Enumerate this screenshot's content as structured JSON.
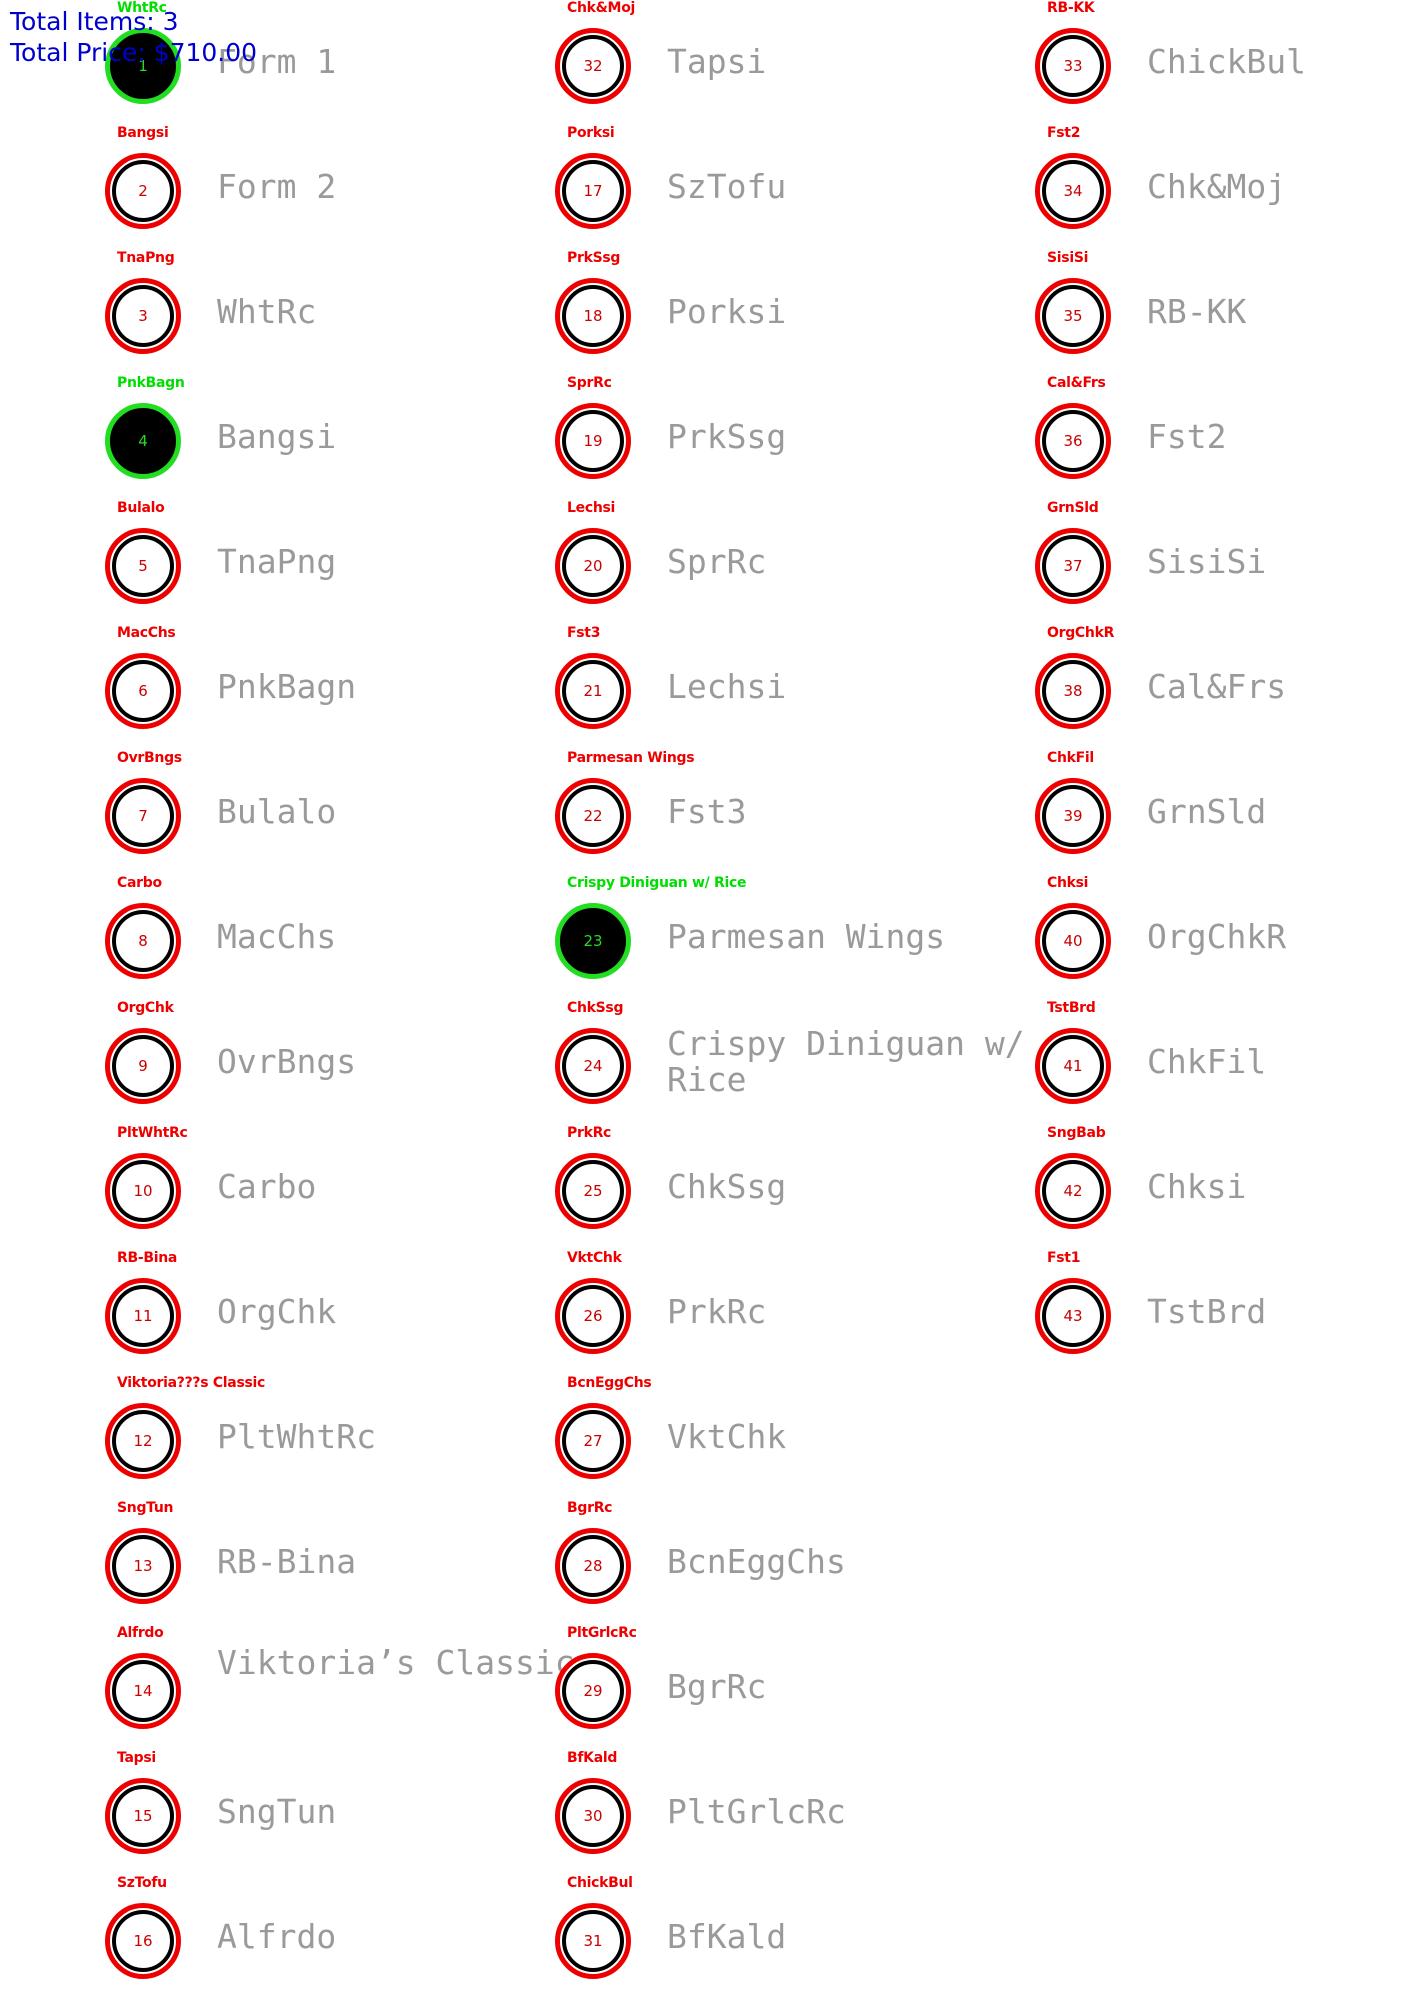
{
  "summary": {
    "total_items": "Total Items: 3",
    "total_price": "Total Price: $710.00"
  },
  "colors": {
    "selected": "#22dd22",
    "unselected": "#ee0000",
    "summary": "#0000cc",
    "name": "#9a9a9a"
  },
  "icon": "circle-select-icon",
  "items": [
    {
      "number": "1",
      "tag": "WhtRc",
      "name": "Form 1",
      "selected": true
    },
    {
      "number": "2",
      "tag": "Bangsi",
      "name": "Form 2",
      "selected": false
    },
    {
      "number": "3",
      "tag": "TnaPng",
      "name": "WhtRc",
      "selected": false
    },
    {
      "number": "4",
      "tag": "PnkBagn",
      "name": "Bangsi",
      "selected": true
    },
    {
      "number": "5",
      "tag": "Bulalo",
      "name": "TnaPng",
      "selected": false
    },
    {
      "number": "6",
      "tag": "MacChs",
      "name": "PnkBagn",
      "selected": false
    },
    {
      "number": "7",
      "tag": "OvrBngs",
      "name": "Bulalo",
      "selected": false
    },
    {
      "number": "8",
      "tag": "Carbo",
      "name": "MacChs",
      "selected": false
    },
    {
      "number": "9",
      "tag": "OrgChk",
      "name": "OvrBngs",
      "selected": false
    },
    {
      "number": "10",
      "tag": "PltWhtRc",
      "name": "Carbo",
      "selected": false
    },
    {
      "number": "11",
      "tag": "RB-Bina",
      "name": "OrgChk",
      "selected": false
    },
    {
      "number": "12",
      "tag": "Viktoria???s Classic",
      "name": "PltWhtRc",
      "selected": false
    },
    {
      "number": "13",
      "tag": "SngTun",
      "name": "RB-Bina",
      "selected": false
    },
    {
      "number": "14",
      "tag": "Alfrdo",
      "name": "Viktoria’s Classic",
      "selected": false
    },
    {
      "number": "15",
      "tag": "Tapsi",
      "name": "SngTun",
      "selected": false
    },
    {
      "number": "16",
      "tag": "SzTofu",
      "name": "Alfrdo",
      "selected": false
    },
    {
      "number": "32",
      "tag": "Chk&Moj",
      "name": "Tapsi",
      "selected": false
    },
    {
      "number": "17",
      "tag": "Porksi",
      "name": "SzTofu",
      "selected": false
    },
    {
      "number": "18",
      "tag": "PrkSsg",
      "name": "Porksi",
      "selected": false
    },
    {
      "number": "19",
      "tag": "SprRc",
      "name": "PrkSsg",
      "selected": false
    },
    {
      "number": "20",
      "tag": "Lechsi",
      "name": "SprRc",
      "selected": false
    },
    {
      "number": "21",
      "tag": "Fst3",
      "name": "Lechsi",
      "selected": false
    },
    {
      "number": "22",
      "tag": "Parmesan Wings",
      "name": "Fst3",
      "selected": false
    },
    {
      "number": "23",
      "tag": "Crispy Diniguan w/ Rice",
      "name": "Parmesan Wings",
      "selected": true
    },
    {
      "number": "24",
      "tag": "ChkSsg",
      "name": "Crispy Diniguan w/ Rice",
      "selected": false
    },
    {
      "number": "25",
      "tag": "PrkRc",
      "name": "ChkSsg",
      "selected": false
    },
    {
      "number": "26",
      "tag": "VktChk",
      "name": "PrkRc",
      "selected": false
    },
    {
      "number": "27",
      "tag": "BcnEggChs",
      "name": "VktChk",
      "selected": false
    },
    {
      "number": "28",
      "tag": "BgrRc",
      "name": "BcnEggChs",
      "selected": false
    },
    {
      "number": "29",
      "tag": "PltGrlcRc",
      "name": "BgrRc",
      "selected": false
    },
    {
      "number": "30",
      "tag": "BfKald",
      "name": "PltGrlcRc",
      "selected": false
    },
    {
      "number": "31",
      "tag": "ChickBul",
      "name": "BfKald",
      "selected": false
    },
    {
      "number": "33",
      "tag": "RB-KK",
      "name": "ChickBul",
      "selected": false
    },
    {
      "number": "34",
      "tag": "Fst2",
      "name": "Chk&Moj",
      "selected": false
    },
    {
      "number": "35",
      "tag": "SisiSi",
      "name": "RB-KK",
      "selected": false
    },
    {
      "number": "36",
      "tag": "Cal&Frs",
      "name": "Fst2",
      "selected": false
    },
    {
      "number": "37",
      "tag": "GrnSld",
      "name": "SisiSi",
      "selected": false
    },
    {
      "number": "38",
      "tag": "OrgChkR",
      "name": "Cal&Frs",
      "selected": false
    },
    {
      "number": "39",
      "tag": "ChkFil",
      "name": "GrnSld",
      "selected": false
    },
    {
      "number": "40",
      "tag": "Chksi",
      "name": "OrgChkR",
      "selected": false
    },
    {
      "number": "41",
      "tag": "TstBrd",
      "name": "ChkFil",
      "selected": false
    },
    {
      "number": "42",
      "tag": "SngBab",
      "name": "Chksi",
      "selected": false
    },
    {
      "number": "43",
      "tag": "Fst1",
      "name": "TstBrd",
      "selected": false
    }
  ]
}
